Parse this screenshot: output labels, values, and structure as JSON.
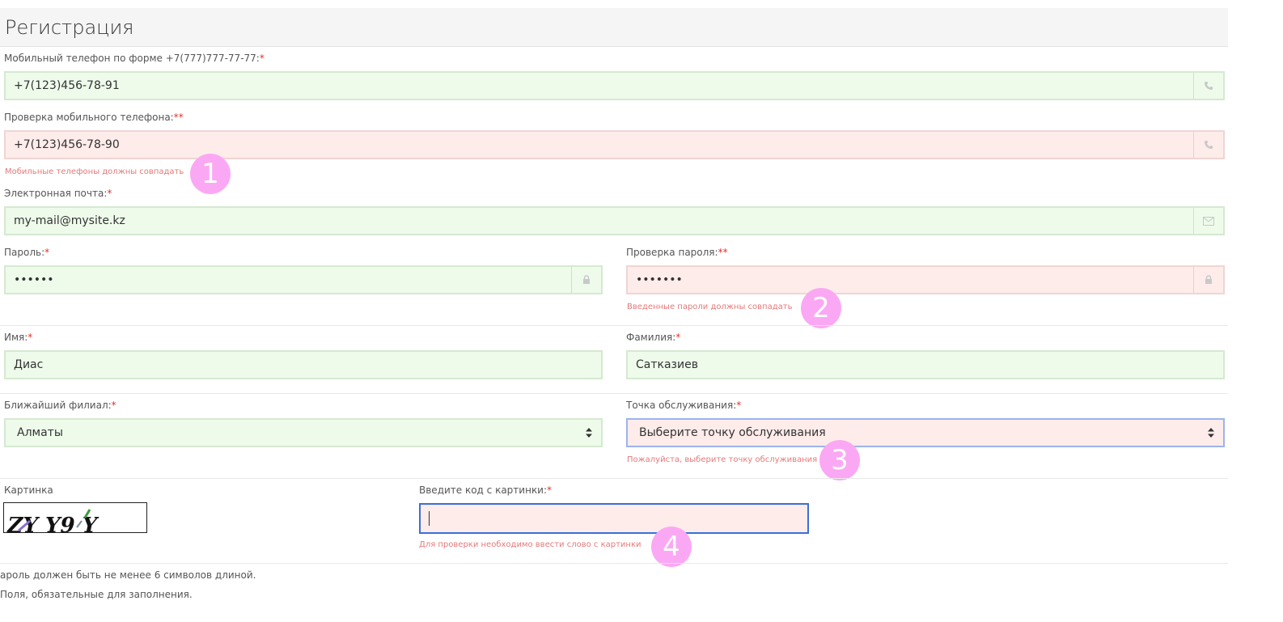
{
  "title": "Регистрация",
  "phone": {
    "label": "Мобильный телефон по форме +7(777)777-77-77:",
    "req": "*",
    "value": "+7(123)456-78-91",
    "icon": "phone-icon"
  },
  "phone_confirm": {
    "label": "Проверка мобильного телефона:",
    "req": "**",
    "value": "+7(123)456-78-90",
    "error": "Мобильные телефоны должны совпадать",
    "icon": "phone-icon"
  },
  "email": {
    "label": "Электронная почта:",
    "req": "*",
    "value": "my-mail@mysite.kz",
    "icon": "envelope-icon"
  },
  "password": {
    "label": "Пароль:",
    "req": "*",
    "value": "••••••",
    "icon": "lock-icon"
  },
  "password_confirm": {
    "label": "Проверка пароля:",
    "req": "**",
    "value": "•••••••",
    "error": "Введенные пароли должны совпадать",
    "icon": "lock-icon"
  },
  "first_name": {
    "label": "Имя:",
    "req": "*",
    "value": "Диас"
  },
  "last_name": {
    "label": "Фамилия:",
    "req": "*",
    "value": "Сатказиев"
  },
  "branch": {
    "label": "Ближайший филиал:",
    "req": "*",
    "value": "Алматы"
  },
  "service_point": {
    "label": "Точка обслуживания:",
    "req": "*",
    "value": "Выберите точку обслуживания",
    "error": "Пожалуйста, выберите точку обслуживания"
  },
  "captcha": {
    "image_label": "Картинка",
    "image_text": "ZY Y9 Y",
    "code_label": "Введите код с картинки:",
    "req": "*",
    "value": "",
    "error": "Для проверки необходимо ввести слово с картинки"
  },
  "notes": {
    "password_len": "ароль должен быть не менее 6 символов длиной.",
    "required": "Поля, обязательные для заполнения."
  },
  "badges": [
    "1",
    "2",
    "3",
    "4"
  ],
  "colors": {
    "ok_bg": "#eefbeb",
    "err_bg": "#fdecea",
    "required": "#e2322d",
    "error_text": "#e5797a",
    "badge": "#fba8f4",
    "focus": "#3a6fd8"
  }
}
